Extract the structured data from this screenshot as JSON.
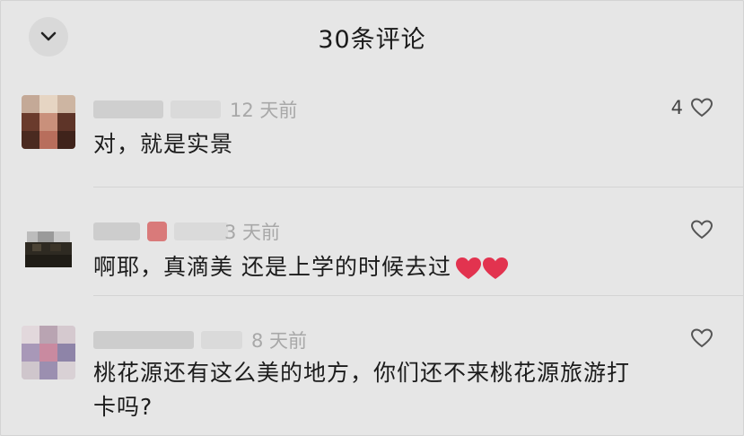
{
  "header": {
    "title": "30条评论",
    "collapse_icon": "chevron-down-icon"
  },
  "comments": [
    {
      "time": "12 天前",
      "text": "对，就是实景",
      "likes": "4"
    },
    {
      "time": "3 天前",
      "text": "啊耶，真滴美  还是上学的时候去过",
      "emoji": "heart-emoji",
      "likes": ""
    },
    {
      "time": "8 天前",
      "text_line1": "桃花源还有这么美的地方，你们还不来桃花源旅游打",
      "text_line2": "卡吗?",
      "likes": ""
    }
  ],
  "colors": {
    "background": "#e6e6e6",
    "text": "#1c1c1c",
    "muted": "#a8a8a8",
    "heart_emoji": "#e2334f"
  }
}
